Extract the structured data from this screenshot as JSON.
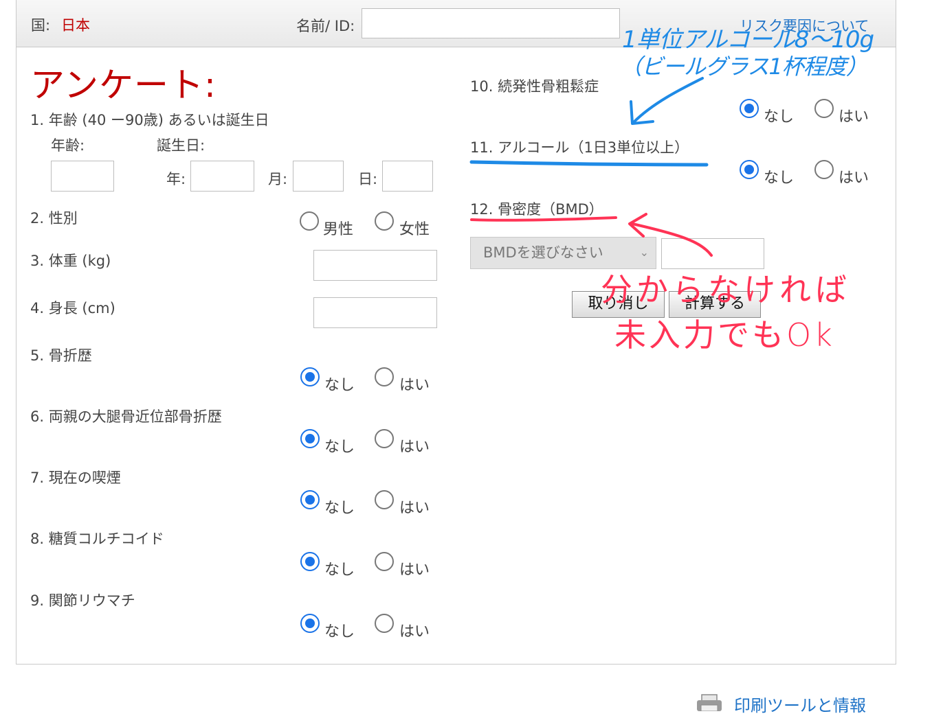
{
  "header": {
    "country_label": "国:",
    "country_value": "日本",
    "name_label": "名前/ ID:",
    "name_value": "",
    "risk_link": "リスク要因について"
  },
  "form": {
    "title": "アンケート:",
    "q1": {
      "label": "1. 年齢 (40 ー90歳) あるいは誕生日",
      "age_label": "年齢:",
      "dob_label": "誕生日:",
      "year_label": "年:",
      "month_label": "月:",
      "day_label": "日:"
    },
    "q2": {
      "label": "2. 性別",
      "opt1": "男性",
      "opt2": "女性"
    },
    "q3": {
      "label": "3. 体重 (kg)"
    },
    "q4": {
      "label": "4. 身長 (cm)"
    },
    "q5": {
      "label": "5. 骨折歴",
      "opt1": "なし",
      "opt2": "はい"
    },
    "q6": {
      "label": "6. 両親の大腿骨近位部骨折歴",
      "opt1": "なし",
      "opt2": "はい"
    },
    "q7": {
      "label": "7. 現在の喫煙",
      "opt1": "なし",
      "opt2": "はい"
    },
    "q8": {
      "label": "8. 糖質コルチコイド",
      "opt1": "なし",
      "opt2": "はい"
    },
    "q9": {
      "label": "9. 関節リウマチ",
      "opt1": "なし",
      "opt2": "はい"
    },
    "q10": {
      "label": "10. 続発性骨粗鬆症",
      "opt1": "なし",
      "opt2": "はい"
    },
    "q11": {
      "label": "11. アルコール（1日3単位以上）",
      "opt1": "なし",
      "opt2": "はい"
    },
    "q12": {
      "label": "12. 骨密度（BMD）",
      "select_value": "BMDを選びなさい"
    },
    "cancel_button": "取り消し",
    "calc_button": "計算する"
  },
  "annotations": {
    "blue_line1": "1単位アルコール8～10g",
    "blue_line2": "（ビールグラス1杯程度）",
    "red_line1": "分からなければ",
    "red_line2": "未入力でもOk"
  },
  "footer": {
    "print_link": "印刷ツールと情報"
  },
  "colors": {
    "accent_red": "#c00000",
    "link_blue": "#1f73c7",
    "radio_blue": "#1a73e8",
    "annot_blue": "#1e8ae6",
    "annot_red": "#ff3355"
  }
}
